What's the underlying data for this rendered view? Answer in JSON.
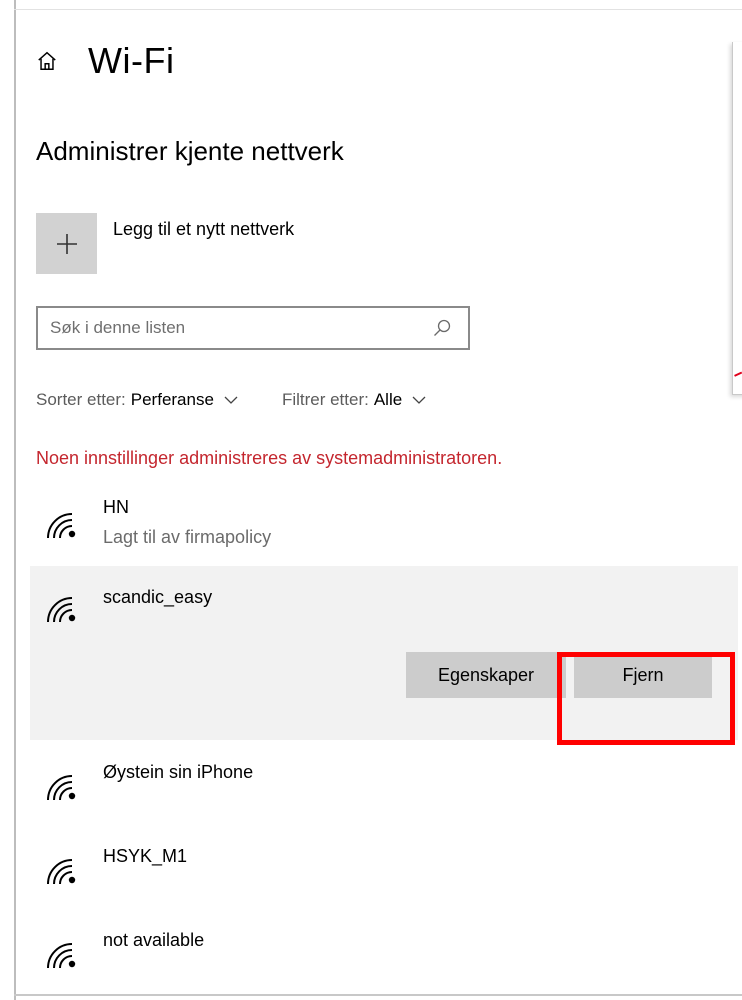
{
  "header": {
    "title": "Wi-Fi",
    "home_icon": "home-icon"
  },
  "subtitle": "Administrer kjente nettverk",
  "add_network": {
    "label": "Legg til et nytt nettverk",
    "icon": "plus-icon"
  },
  "search": {
    "placeholder": "Søk i denne listen",
    "icon": "search-icon"
  },
  "sort": {
    "label": "Sorter etter:",
    "value": "Perferanse"
  },
  "filter": {
    "label": "Filtrer etter:",
    "value": "Alle"
  },
  "policy_notice": "Noen innstillinger administreres av systemadministratoren.",
  "networks": [
    {
      "name": "HN",
      "subtitle": "Lagt til av firmapolicy"
    },
    {
      "name": "scandic_easy",
      "selected": true
    },
    {
      "name": "Øystein sin iPhone"
    },
    {
      "name": "HSYK_M1"
    },
    {
      "name": "not available"
    }
  ],
  "actions": {
    "properties_label": "Egenskaper",
    "remove_label": "Fjern"
  },
  "colors": {
    "policy_text": "#c4262e",
    "highlight": "#ff0000",
    "selected_bg": "#f2f2f2",
    "button_bg": "#cccccc"
  }
}
